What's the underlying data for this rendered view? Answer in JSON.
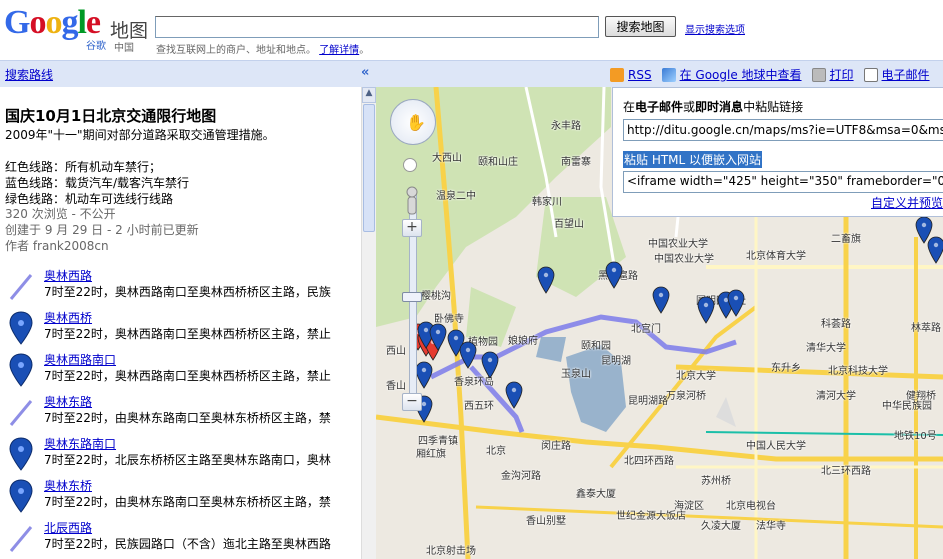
{
  "header": {
    "logo_text": "Google",
    "logo_sub_cn": "谷歌",
    "maps_label": "地图",
    "region_label": "中国",
    "search_value": "",
    "search_button": "搜索地图",
    "show_options": "显示搜索选项",
    "hint_text": "查找互联网上的商户、地址和地点。",
    "hint_link": "了解详情",
    "hint_suffix": "。"
  },
  "topbar": {
    "search_routes": "搜索路线",
    "collapse": "«",
    "rss": "RSS",
    "google_earth": "在 Google 地球中查看",
    "print": "打印",
    "email": "电子邮件"
  },
  "sidebar": {
    "title": "国庆10月1日北京交通限行地图",
    "description": "2009年\"十一\"期间对部分道路采取交通管理措施。",
    "legend": [
      "红色线路：所有机动车禁行；",
      "蓝色线路：载货汽车/载客汽车禁行",
      "绿色线路：机动车可选线行线路"
    ],
    "views": "320 次浏览 - 不公开",
    "created": "创建于 9 月 29 日 - 2 小时前已更新",
    "author": "作者 frank2008cn",
    "items": [
      {
        "type": "line",
        "name": "奥林西路",
        "desc": "7时至22时，奥林西路南口至奥林西桥桥区主路，民族"
      },
      {
        "type": "pin",
        "name": "奥林西桥",
        "desc": "7时至22时，奥林西路南口至奥林西桥桥区主路，禁止"
      },
      {
        "type": "pin",
        "name": "奥林西路南口",
        "desc": "7时至22时，奥林西路南口至奥林西桥桥区主路，禁止"
      },
      {
        "type": "line",
        "name": "奥林东路",
        "desc": "7时至22时，由奥林东路南口至奥林东桥桥区主路，禁"
      },
      {
        "type": "pin",
        "name": "奥林东路南口",
        "desc": "7时至22时，北辰东桥桥区主路至奥林东路南口，奥林"
      },
      {
        "type": "pin",
        "name": "奥林东桥",
        "desc": "7时至22时，由奥林东路南口至奥林东桥桥区主路，禁"
      },
      {
        "type": "line",
        "name": "北辰西路",
        "desc": "7时至22时，民族园路口（不含）迤北主路至奥林西路"
      }
    ]
  },
  "map": {
    "zoom_in": "+",
    "zoom_out": "−",
    "labels": [
      {
        "text": "大西山"
      },
      {
        "text": "颐和山庄"
      },
      {
        "text": "南雷寨"
      },
      {
        "text": "温泉二中"
      },
      {
        "text": "韩家川"
      },
      {
        "text": "百望山"
      },
      {
        "text": "樱桃沟"
      },
      {
        "text": "卧佛寺"
      },
      {
        "text": "植物园"
      },
      {
        "text": "娘娘府"
      },
      {
        "text": "颐和园"
      },
      {
        "text": "北宫门"
      },
      {
        "text": "昆明湖"
      },
      {
        "text": "玉泉山"
      },
      {
        "text": "香山"
      },
      {
        "text": "香泉环岛"
      },
      {
        "text": "中国农业大学"
      },
      {
        "text": "北京体育大学"
      },
      {
        "text": "圆明园遗址"
      },
      {
        "text": "北京大学"
      },
      {
        "text": "清华大学"
      },
      {
        "text": "东升乡"
      },
      {
        "text": "万泉河桥"
      },
      {
        "text": "闵庄路"
      },
      {
        "text": "四季青镇"
      },
      {
        "text": "西五环"
      },
      {
        "text": "北四环西路"
      },
      {
        "text": "北三环西路"
      },
      {
        "text": "中国人民大学"
      },
      {
        "text": "苏州桥"
      },
      {
        "text": "海淀区"
      },
      {
        "text": "鑫泰大厦"
      },
      {
        "text": "香山别墅"
      },
      {
        "text": "世纪金源大饭店"
      },
      {
        "text": "北京电视台"
      },
      {
        "text": "久凌大厦"
      },
      {
        "text": "法华寺"
      },
      {
        "text": "二畜旗"
      },
      {
        "text": "科荟路"
      },
      {
        "text": "林萃路"
      },
      {
        "text": "健翔桥"
      },
      {
        "text": "地铁10号"
      },
      {
        "text": "中国农业大学"
      },
      {
        "text": "北京科技大学"
      },
      {
        "text": "永丰路"
      },
      {
        "text": "黑山扈路"
      },
      {
        "text": "昆明湖路"
      },
      {
        "text": "厢红旗"
      },
      {
        "text": "北京射击场"
      },
      {
        "text": "金沟河路"
      },
      {
        "text": "西山"
      },
      {
        "text": "北京"
      },
      {
        "text": "中华民族园"
      },
      {
        "text": "清河大学"
      }
    ]
  },
  "popup": {
    "paste_link_label_1": "在",
    "paste_link_email": "电子邮件",
    "paste_link_or": "或",
    "paste_link_im": "即时消息",
    "paste_link_suffix": "中粘贴链接",
    "link_url": "http://ditu.google.cn/maps/ms?ie=UTF8&msa=0&msid=",
    "embed_label": "粘贴 HTML 以便嵌入网站",
    "embed_code": "<iframe width=\"425\" height=\"350\" frameborder=\"0\" scro",
    "customize_link": "自定义并预览"
  },
  "colors": {
    "link_blue": "#0000cc",
    "route_blue": "#7b7bea",
    "pin_blue": "#1a4fb5",
    "pin_red": "#e53b30",
    "toolbar_bg": "#dde6f7"
  }
}
